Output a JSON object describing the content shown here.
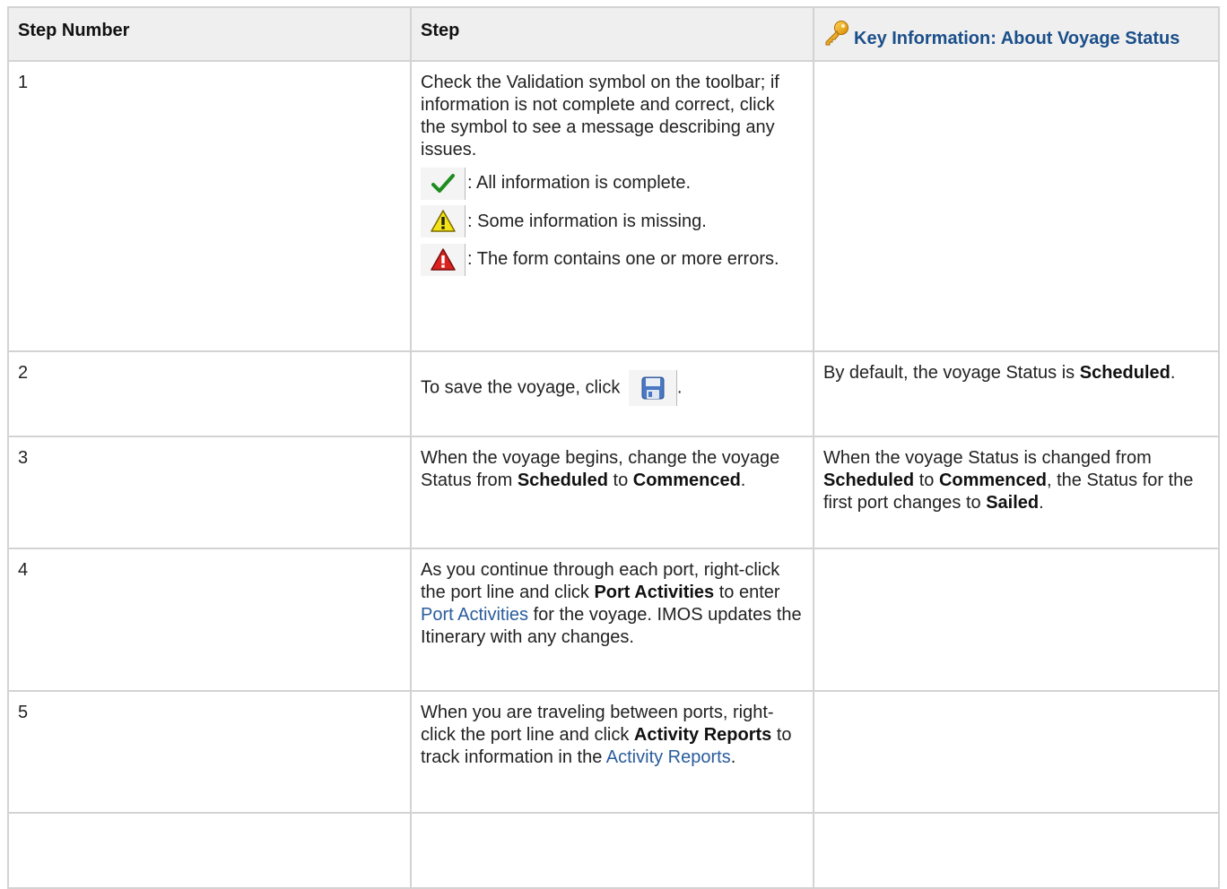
{
  "table": {
    "headers": {
      "step_number": "Step Number",
      "step": "Step",
      "key_info": "Key Information: About Voyage Status"
    },
    "rows": [
      {
        "number": "1",
        "step_intro": "Check the Validation symbol on the toolbar; if information is not complete and correct, click the symbol to see a message describing any issues.",
        "icons": [
          {
            "icon": "checkmark-icon",
            "text": ": All information is complete."
          },
          {
            "icon": "warning-yellow-icon",
            "text": ": Some information is missing."
          },
          {
            "icon": "error-red-icon",
            "text": ": The form contains one or more errors."
          }
        ],
        "key_info": ""
      },
      {
        "number": "2",
        "step_text": "To save the voyage, click",
        "step_after": ".",
        "key_info_pre": "By default, the voyage Status is ",
        "key_info_bold": "Scheduled",
        "key_info_post": "."
      },
      {
        "number": "3",
        "step_pre": "When the voyage begins, change the voyage Status from ",
        "step_bold1": "Scheduled",
        "step_mid": " to ",
        "step_bold2": "Commenced",
        "step_post": ".",
        "key_pre": "When the voyage Status is changed from ",
        "key_bold1": "Scheduled",
        "key_mid1": " to ",
        "key_bold2": "Commenced",
        "key_mid2": ", the Status for the first port changes to ",
        "key_bold3": "Sailed",
        "key_post": "."
      },
      {
        "number": "4",
        "step_pre": "As you continue through each port, right-click the port line and click ",
        "step_bold": "Port Activities",
        "step_mid": " to enter ",
        "step_link": "Port Activities",
        "step_post": " for the voyage. IMOS updates the Itinerary with any changes.",
        "key_info": ""
      },
      {
        "number": "5",
        "step_pre": "When you are traveling between ports, right-click the port line and click ",
        "step_bold": "Activity Reports",
        "step_mid": " to track information in the ",
        "step_link": "Activity Reports",
        "step_post": ".",
        "key_info": ""
      }
    ]
  },
  "colors": {
    "header_bg": "#efefef",
    "border": "#d3d3d3",
    "link": "#2a5c9c",
    "key_header": "#1b4f8a"
  }
}
